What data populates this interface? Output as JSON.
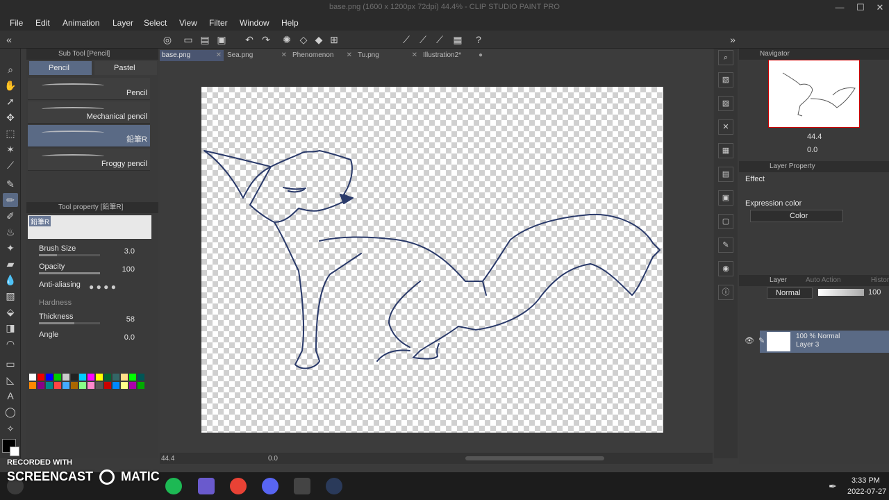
{
  "window": {
    "title": "base.png (1600 x 1200px 72dpi) 44.4% - CLIP STUDIO PAINT PRO",
    "controls": [
      "—",
      "☐",
      "✕"
    ]
  },
  "menu": [
    "File",
    "Edit",
    "Animation",
    "Layer",
    "Select",
    "View",
    "Filter",
    "Window",
    "Help"
  ],
  "subtool_panel": {
    "title": "Sub Tool [Pencil]",
    "tabs": [
      "Pencil",
      "Pastel"
    ],
    "brushes": [
      "Pencil",
      "Mechanical pencil",
      "鉛筆R",
      "Froggy pencil"
    ]
  },
  "tool_property": {
    "title": "Tool property [鉛筆R]",
    "preset": "鉛筆R",
    "brush_size": {
      "label": "Brush Size",
      "value": "3.0"
    },
    "opacity": {
      "label": "Opacity",
      "value": "100"
    },
    "anti_aliasing": {
      "label": "Anti-aliasing"
    },
    "hardness": {
      "label": "Hardness"
    },
    "thickness": {
      "label": "Thickness",
      "value": "58"
    },
    "angle": {
      "label": "Angle",
      "value": "0.0"
    }
  },
  "doc_tabs": [
    "base.png",
    "Sea.png",
    "Phenomenon",
    "Tu.png",
    "Illustration2*"
  ],
  "status": {
    "zoom": "44.4",
    "rotation": "0.0"
  },
  "navigator": {
    "title": "Navigator",
    "zoom": "44.4",
    "rotation": "0.0"
  },
  "layer_property": {
    "title": "Layer Property",
    "effect_label": "Effect",
    "expression_label": "Expression color",
    "expression_value": "Color"
  },
  "layer_panel": {
    "title": "Layer",
    "tab2": "Auto Action",
    "tab3": "History",
    "blend": "Normal",
    "opacity": "100",
    "layers": [
      {
        "line1": "100 % Normal",
        "line2": "Layer 3"
      }
    ]
  },
  "taskbar": {
    "time": "3:33 PM",
    "date": "2022-07-27"
  },
  "watermark": {
    "line1": "RECORDED WITH",
    "line2": "SCREENCAST",
    "line3": "MATIC"
  },
  "colors": {
    "accent": "#5a6a85",
    "line_art": "#2a3a6a"
  }
}
